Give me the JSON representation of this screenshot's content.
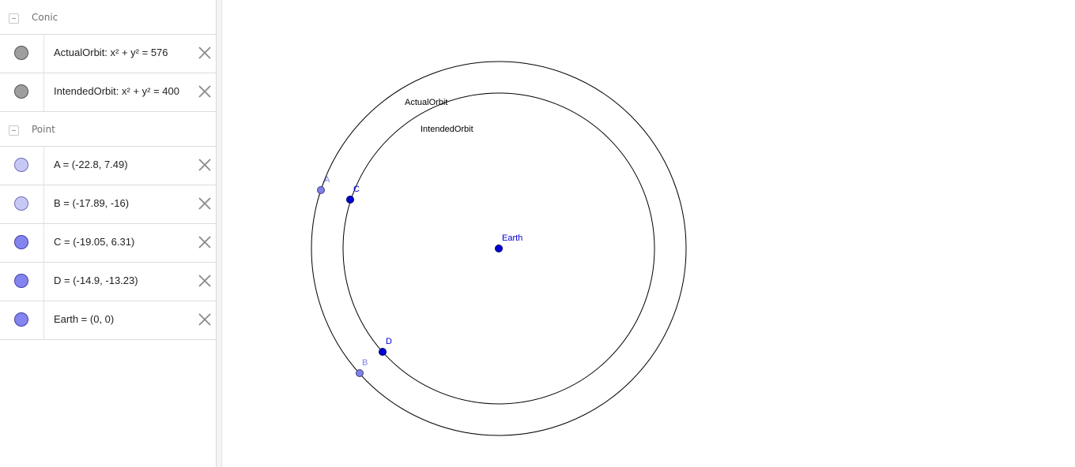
{
  "algebra": {
    "groups": [
      {
        "title": "Conic",
        "items": [
          {
            "text": "ActualOrbit: x² + y² = 576",
            "color": "#9e9e9e"
          },
          {
            "text": "IntendedOrbit: x² + y² = 400",
            "color": "#9e9e9e"
          }
        ]
      },
      {
        "title": "Point",
        "items": [
          {
            "text": "A = (-22.8, 7.49)",
            "color": "#c8c8f5"
          },
          {
            "text": "B = (-17.89, -16)",
            "color": "#c8c8f5"
          },
          {
            "text": "C = (-19.05, 6.31)",
            "color": "#8484f0"
          },
          {
            "text": "D = (-14.9, -13.23)",
            "color": "#8484f0"
          },
          {
            "text": "Earth = (0, 0)",
            "color": "#8484f0"
          }
        ]
      }
    ]
  },
  "graphics": {
    "labels": {
      "actual_orbit": "ActualOrbit",
      "intended_orbit": "IntendedOrbit",
      "earth": "Earth",
      "A": "A",
      "B": "B",
      "C": "C",
      "D": "D"
    },
    "colors": {
      "light_point": "#8080e8",
      "dark_point": "#0000d8",
      "curve": "#000000"
    }
  }
}
